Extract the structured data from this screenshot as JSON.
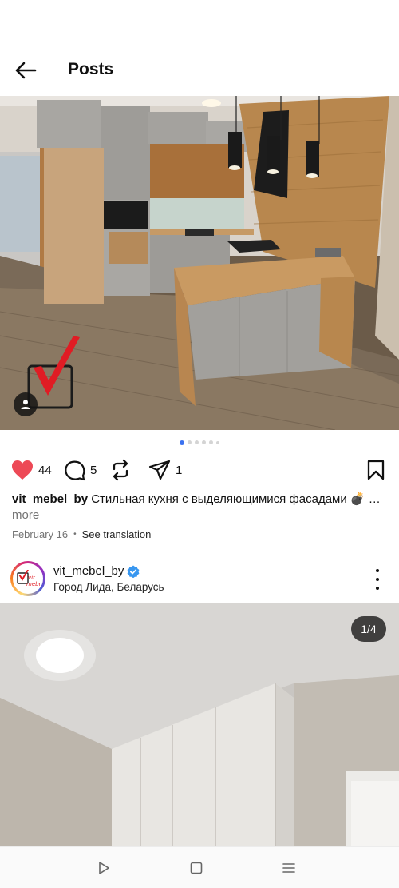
{
  "header": {
    "title": "Posts",
    "back_icon": "arrow-left-icon"
  },
  "post1": {
    "carousel": {
      "slides": 6,
      "active_index": 0,
      "accent": "#3b72f0"
    },
    "actions": {
      "likes": "44",
      "comments": "5",
      "shares": "1",
      "like_color": "#ed4956"
    },
    "caption": {
      "username": "vit_mebel_by",
      "text": "Стильная кухня с выделяющимися фасадами 💣 🔥 …",
      "more_label": "more"
    },
    "date": "February 16",
    "translate_label": "See translation"
  },
  "post2": {
    "username": "vit_mebel_by",
    "verified_color": "#3897f0",
    "location": "Город Лида, Беларусь",
    "slide_counter": "1/4"
  },
  "navbar": {
    "icons": [
      "back-triangle-icon",
      "home-square-icon",
      "menu-lines-icon"
    ]
  }
}
